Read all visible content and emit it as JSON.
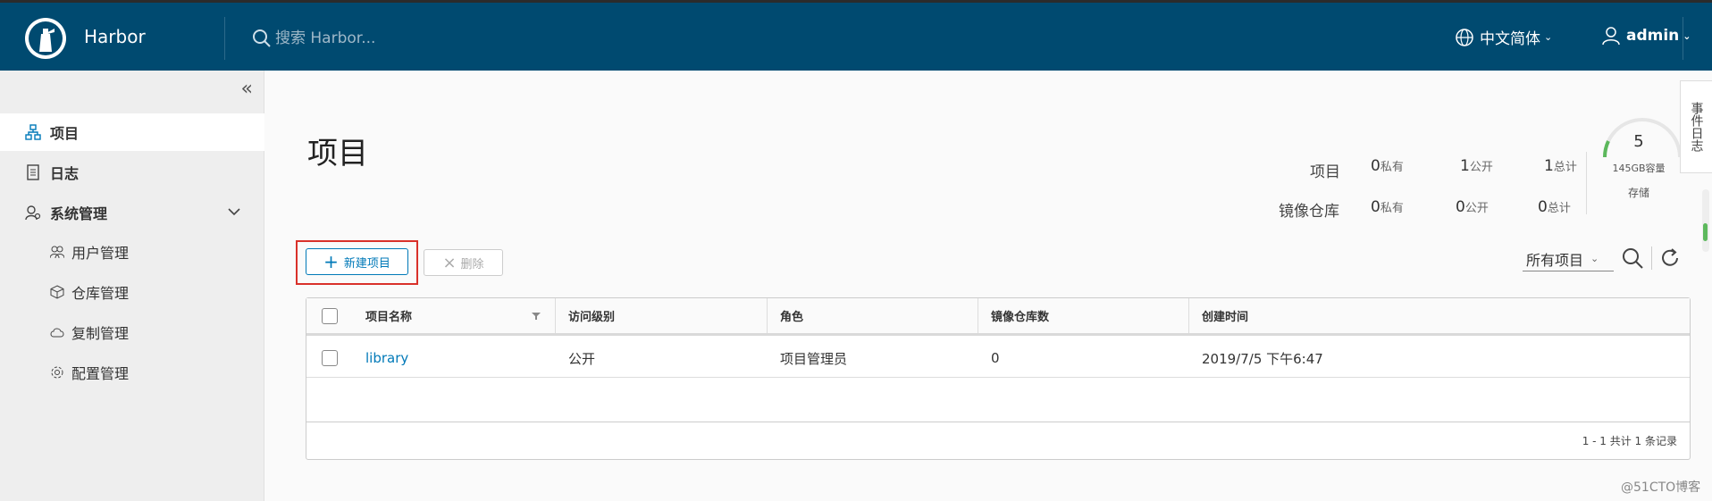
{
  "header": {
    "brand": "Harbor",
    "search_placeholder": "搜索 Harbor...",
    "language": "中文简体",
    "user": "admin"
  },
  "sidebar": {
    "items": [
      {
        "label": "项目",
        "icon": "projects-icon",
        "active": true
      },
      {
        "label": "日志",
        "icon": "logs-icon"
      },
      {
        "label": "系统管理",
        "icon": "admin-icon"
      }
    ],
    "sub_items": [
      {
        "label": "用户管理",
        "icon": "users-icon"
      },
      {
        "label": "仓库管理",
        "icon": "registry-icon"
      },
      {
        "label": "复制管理",
        "icon": "replication-icon"
      },
      {
        "label": "配置管理",
        "icon": "gear-icon"
      }
    ]
  },
  "main": {
    "title": "项目",
    "stats": {
      "projects_label": "项目",
      "repos_label": "镜像仓库",
      "projects": {
        "private": "0",
        "public": "1",
        "total": "1"
      },
      "repos": {
        "private": "0",
        "public": "0",
        "total": "0"
      },
      "private_label": "私有",
      "public_label": "公开",
      "total_label": "总计"
    },
    "storage": {
      "value": "5",
      "capacity": "145GB容量",
      "label": "存储"
    },
    "side_tab": "事件日志",
    "toolbar": {
      "new_button": "新建项目",
      "delete_button": "删除",
      "filter_value": "所有项目"
    },
    "table": {
      "columns": [
        "项目名称",
        "访问级别",
        "角色",
        "镜像仓库数",
        "创建时间"
      ],
      "rows": [
        {
          "name": "library",
          "access": "公开",
          "role": "项目管理员",
          "repo_count": "0",
          "created": "2019/7/5 下午6:47"
        }
      ],
      "footer": "1 - 1 共计 1 条记录"
    },
    "watermark": "@51CTO博客"
  },
  "colors": {
    "header_bg": "#004a70",
    "accent": "#0079b8",
    "highlight": "#d9312a"
  }
}
